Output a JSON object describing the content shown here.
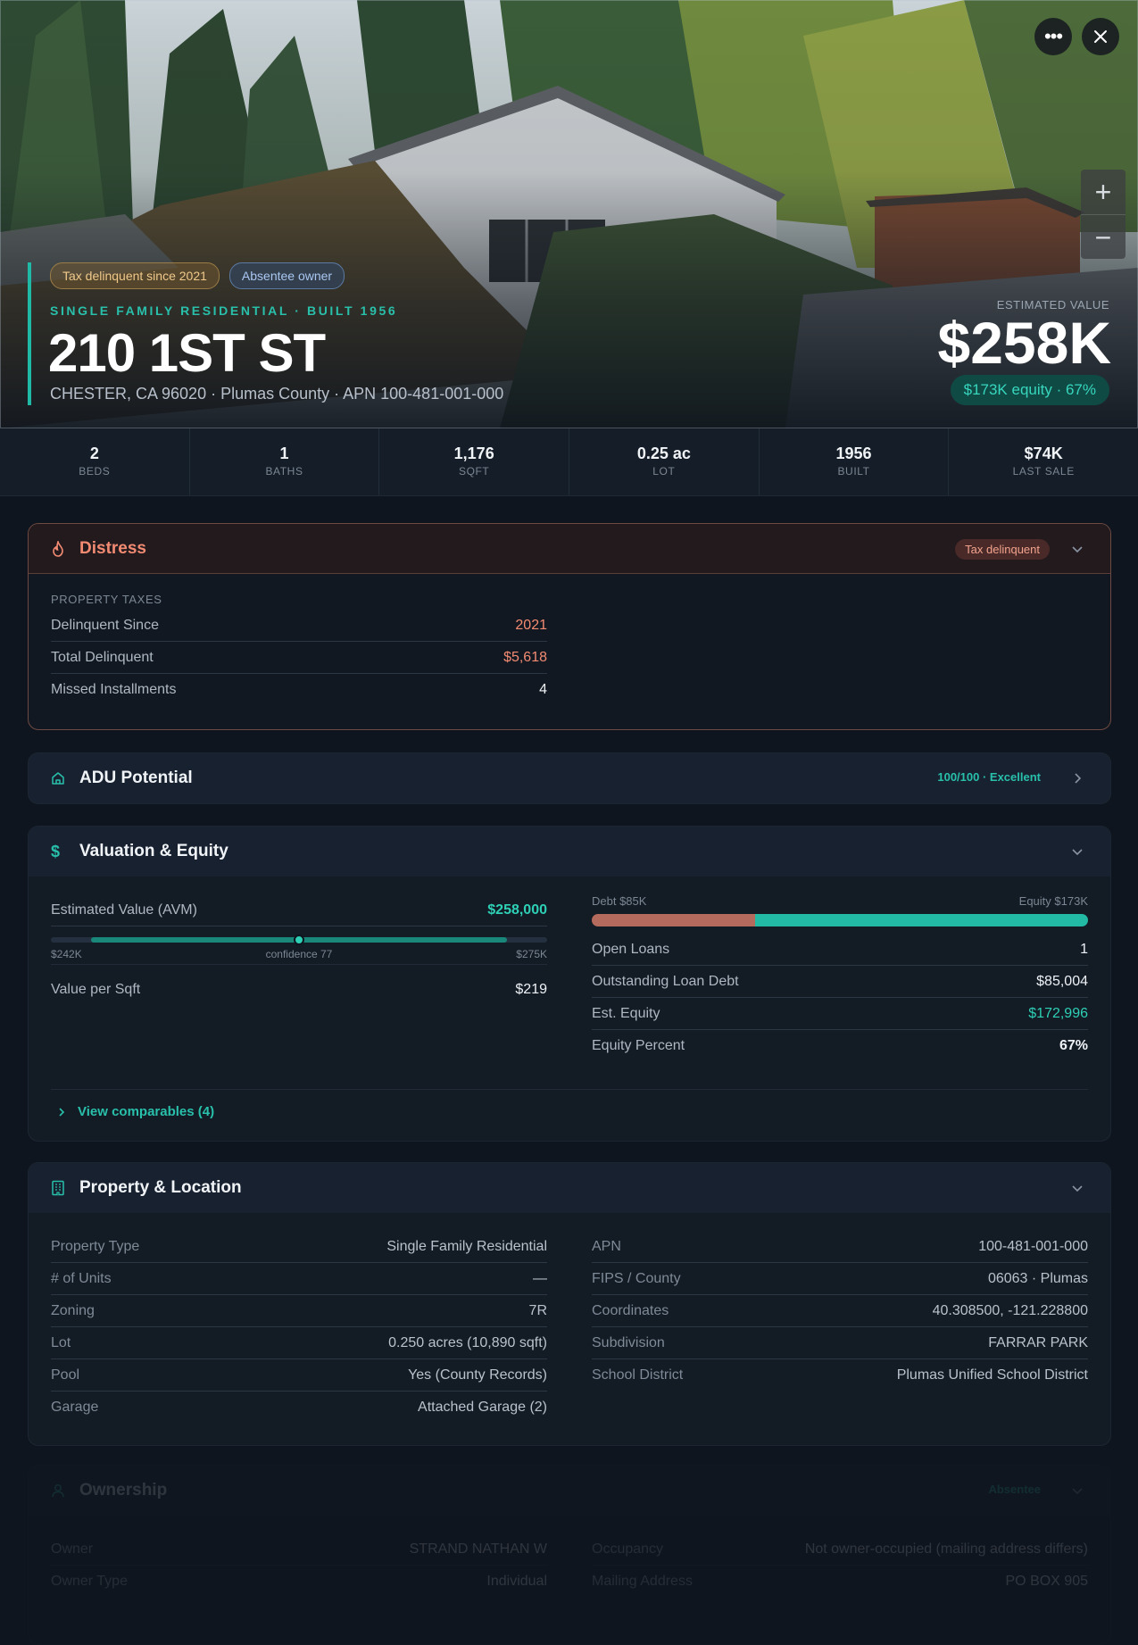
{
  "hero": {
    "tags": [
      "Tax delinquent since 2021",
      "Absentee owner"
    ],
    "subtitle": "SINGLE FAMILY RESIDENTIAL · BUILT 1956",
    "address": "210 1ST ST",
    "location": "CHESTER, CA 96020 · Plumas County · APN 100-481-001-000",
    "estimated_label": "ESTIMATED VALUE",
    "estimated_value": "$258K",
    "equity_pill": "$173K equity · 67%",
    "more_icon": "more-horizontal-icon",
    "close_icon": "close-icon",
    "zoom_in": "+",
    "zoom_out": "−"
  },
  "stats": [
    {
      "value": "2",
      "label": "BEDS"
    },
    {
      "value": "1",
      "label": "BATHS"
    },
    {
      "value": "1,176",
      "label": "SQFT"
    },
    {
      "value": "0.25 ac",
      "label": "LOT"
    },
    {
      "value": "1956",
      "label": "BUILT"
    },
    {
      "value": "$74K",
      "label": "LAST SALE"
    }
  ],
  "distress": {
    "title": "Distress",
    "badge": "Tax delinquent",
    "section": "PROPERTY TAXES",
    "rows": [
      {
        "k": "Delinquent Since",
        "v": "2021"
      },
      {
        "k": "Total Delinquent",
        "v": "$5,618"
      },
      {
        "k": "Missed Installments",
        "v": "4"
      }
    ]
  },
  "adu": {
    "title": "ADU Potential",
    "badge": "100/100 · Excellent"
  },
  "valuation": {
    "title": "Valuation & Equity",
    "avm_label": "Estimated Value (AVM)",
    "avm_value": "$258,000",
    "range_low": "$242K",
    "range_high": "$275K",
    "confidence": "confidence 77",
    "avm_position": 0.5,
    "value_per_sqft_label": "Value per Sqft",
    "value_per_sqft": "$219",
    "debt_label": "Debt $85K",
    "equity_label": "Equity $173K",
    "debt_fraction": 0.33,
    "rows": [
      {
        "k": "Open Loans",
        "v": "1"
      },
      {
        "k": "Outstanding Loan Debt",
        "v": "$85,004"
      },
      {
        "k": "Est. Equity",
        "v": "$172,996"
      },
      {
        "k": "Equity Percent",
        "v": "67%"
      }
    ],
    "comparables": "View comparables (4)"
  },
  "property": {
    "title": "Property & Location",
    "left": [
      {
        "k": "Property Type",
        "v": "Single Family Residential"
      },
      {
        "k": "# of Units",
        "v": "—"
      },
      {
        "k": "Zoning",
        "v": "7R"
      },
      {
        "k": "Lot",
        "v": "0.250 acres (10,890 sqft)"
      },
      {
        "k": "Pool",
        "v": "Yes (County Records)"
      },
      {
        "k": "Garage",
        "v": "Attached Garage (2)"
      }
    ],
    "right": [
      {
        "k": "APN",
        "v": "100-481-001-000"
      },
      {
        "k": "FIPS / County",
        "v": "06063 · Plumas"
      },
      {
        "k": "Coordinates",
        "v": "40.308500, -121.228800"
      },
      {
        "k": "Subdivision",
        "v": "FARRAR PARK"
      },
      {
        "k": "School District",
        "v": "Plumas Unified School District"
      }
    ]
  },
  "ownership": {
    "title": "Ownership",
    "badge": "Absentee",
    "left": [
      {
        "k": "Owner",
        "v": "STRAND NATHAN W"
      },
      {
        "k": "Owner Type",
        "v": "Individual"
      }
    ],
    "right": [
      {
        "k": "Occupancy",
        "v": "Not owner-occupied (mailing address differs)"
      },
      {
        "k": "Mailing Address",
        "v": "PO BOX 905"
      }
    ]
  }
}
